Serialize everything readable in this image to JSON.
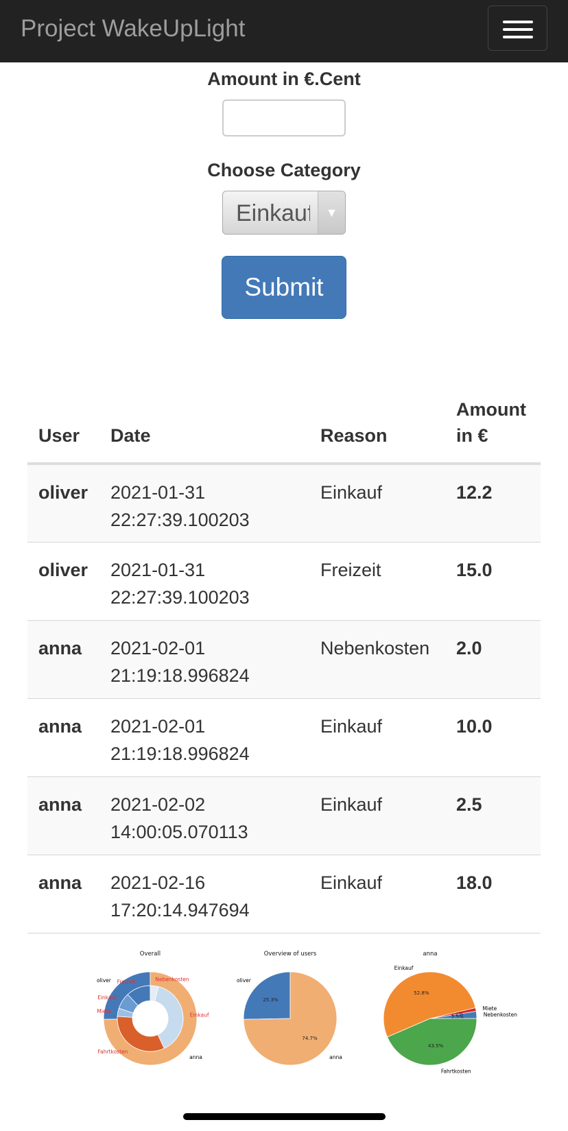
{
  "navbar": {
    "brand": "Project WakeUpLight"
  },
  "form": {
    "amount_label": "Amount in €.Cent",
    "amount_value": "",
    "category_label": "Choose Category",
    "category_selected": "Einkauf",
    "submit_label": "Submit"
  },
  "table": {
    "headers": {
      "user": "User",
      "date": "Date",
      "reason": "Reason",
      "amount_line1": "Amount",
      "amount_line2": "in €"
    },
    "rows": [
      {
        "user": "oliver",
        "date": "2021-01-31",
        "time": "22:27:39.100203",
        "reason": "Einkauf",
        "amount": "12.2"
      },
      {
        "user": "oliver",
        "date": "2021-01-31",
        "time": "22:27:39.100203",
        "reason": "Freizeit",
        "amount": "15.0"
      },
      {
        "user": "anna",
        "date": "2021-02-01",
        "time": "21:19:18.996824",
        "reason": "Nebenkosten",
        "amount": "2.0"
      },
      {
        "user": "anna",
        "date": "2021-02-01",
        "time": "21:19:18.996824",
        "reason": "Einkauf",
        "amount": "10.0"
      },
      {
        "user": "anna",
        "date": "2021-02-02",
        "time": "14:00:05.070113",
        "reason": "Einkauf",
        "amount": "2.5"
      },
      {
        "user": "anna",
        "date": "2021-02-16",
        "time": "17:20:14.947694",
        "reason": "Einkauf",
        "amount": "18.0"
      }
    ]
  },
  "chart_data": [
    {
      "type": "pie",
      "title": "Overall",
      "outer": [
        {
          "label": "oliver",
          "value": 25.3,
          "color": "#4479b8"
        },
        {
          "label": "anna",
          "value": 74.7,
          "color": "#f0ae73"
        }
      ],
      "inner": [
        {
          "label": "Freizeit",
          "value": 12,
          "color": "#4479b8"
        },
        {
          "label": "Einkauf",
          "value": 8,
          "color": "#6a9bd1"
        },
        {
          "label": "Miete",
          "value": 4,
          "color": "#9dbfe4"
        },
        {
          "label": "Fahrtkosten",
          "value": 33,
          "color": "#d95f2b"
        },
        {
          "label": "Einkauf",
          "value": 39,
          "color": "#c7dbef"
        },
        {
          "label": "Nebenkosten",
          "value": 4,
          "color": "#e4ecf5"
        }
      ],
      "labels": [
        "oliver",
        "Freizeit",
        "Einkauf",
        "Miete",
        "Fahrtkosten",
        "anna",
        "Einkauf",
        "Nebenkosten"
      ]
    },
    {
      "type": "pie",
      "title": "Overview of users",
      "slices": [
        {
          "label": "oliver",
          "value": 25.3,
          "pct": "25.3%",
          "color": "#4479b8"
        },
        {
          "label": "anna",
          "value": 74.7,
          "pct": "74.7%",
          "color": "#f0ae73"
        }
      ]
    },
    {
      "type": "pie",
      "title": "anna",
      "slices": [
        {
          "label": "Nebenkosten",
          "value": 2.5,
          "pct": "2.5%",
          "color": "#4479b8"
        },
        {
          "label": "Miete",
          "value": 1.2,
          "pct": "1.2%",
          "color": "#d62728"
        },
        {
          "label": "Einkauf",
          "value": 52.8,
          "pct": "52.8%",
          "color": "#f28a30"
        },
        {
          "label": "Fahrtkosten",
          "value": 43.5,
          "pct": "43.5%",
          "color": "#4ca64c"
        }
      ]
    }
  ]
}
